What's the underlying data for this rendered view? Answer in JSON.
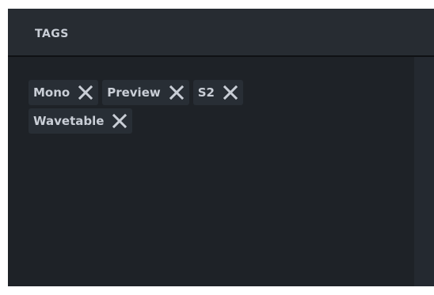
{
  "panel": {
    "title": "TAGS"
  },
  "tags": [
    {
      "label": "Mono"
    },
    {
      "label": "Preview"
    },
    {
      "label": "S2"
    },
    {
      "label": "Wavetable"
    }
  ],
  "icons": {
    "remove": "close-icon"
  },
  "colors": {
    "panel_bg": "#1e2227",
    "header_bg": "#272c32",
    "tag_bg": "#282e35",
    "text": "#c9ced6"
  }
}
